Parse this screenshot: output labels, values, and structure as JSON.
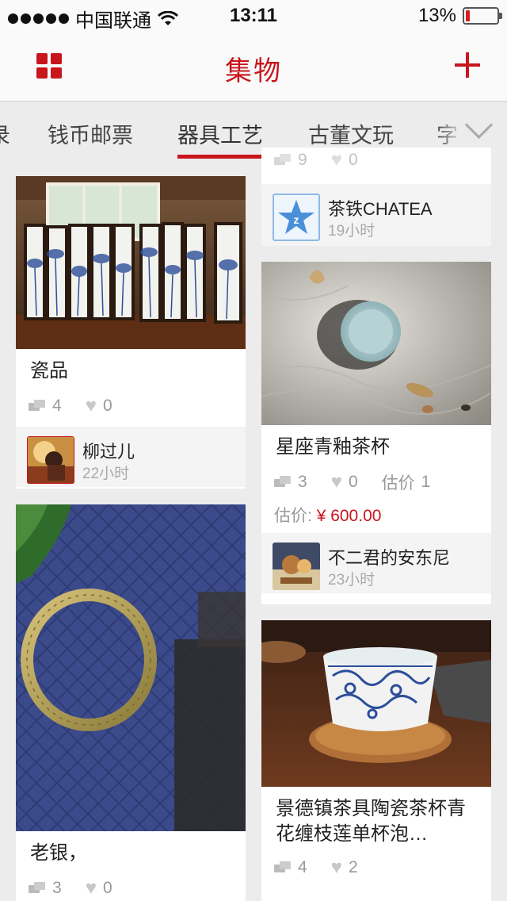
{
  "status_bar": {
    "carrier": "中国联通",
    "time": "13:11",
    "battery": "13%",
    "battery_level": 0.13,
    "wifi_icon": "wifi-icon",
    "battery_color": "#d21f1f"
  },
  "navbar": {
    "title": "集物",
    "left_icon": "grid-icon",
    "right_icon": "plus-icon",
    "accent": "#c8161d"
  },
  "tabs": {
    "items": [
      {
        "label": "录"
      },
      {
        "label": "钱币邮票"
      },
      {
        "label": "器具工艺"
      },
      {
        "label": "古董文玩"
      },
      {
        "label": "字"
      }
    ],
    "active_index": 2,
    "expand_icon": "chevron-down-icon"
  },
  "feed": {
    "left": [
      {
        "title": "瓷品",
        "comments": "4",
        "likes": "0",
        "user": {
          "name": "柳过儿",
          "time": "22小时"
        }
      },
      {
        "title": "老银，",
        "comments": "3",
        "likes": "0"
      }
    ],
    "right": [
      {
        "comments": "9",
        "likes": "0",
        "user": {
          "name": "茶铁CHATEA",
          "time": "19小时"
        }
      },
      {
        "title": "星座青釉茶杯",
        "comments": "3",
        "likes": "0",
        "estimate_label": "估价",
        "estimate_count": "1",
        "price_label": "估价:",
        "price_value": "¥ 600.00",
        "user": {
          "name": "不二君的安东尼",
          "time": "23小时"
        }
      },
      {
        "title": "景德镇茶具陶瓷茶杯青花缠枝莲单杯泡…",
        "comments": "4",
        "likes": "2"
      }
    ]
  }
}
